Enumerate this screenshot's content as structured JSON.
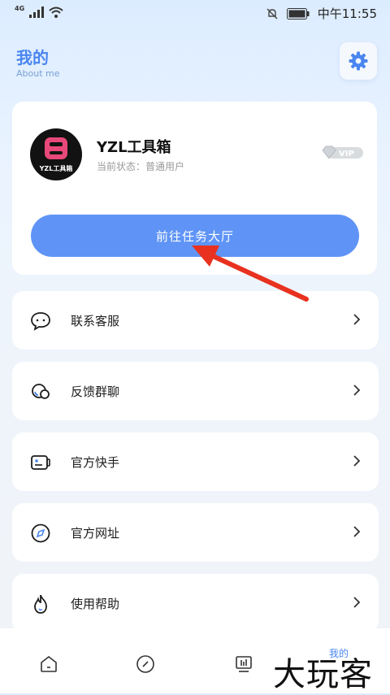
{
  "status_bar": {
    "network": "4G",
    "time": "中午11:55"
  },
  "header": {
    "title": "我的",
    "subtitle": "About me"
  },
  "profile": {
    "avatar_text": "YZL工具箱",
    "name": "YZL工具箱",
    "status": "当前状态：普通用户",
    "badge": "VIP",
    "task_button": "前往任务大厅"
  },
  "menu": [
    {
      "label": "联系客服",
      "icon": "chat-bubble-icon"
    },
    {
      "label": "反馈群聊",
      "icon": "group-chat-icon"
    },
    {
      "label": "官方快手",
      "icon": "video-camera-icon"
    },
    {
      "label": "官方网址",
      "icon": "compass-icon"
    },
    {
      "label": "使用帮助",
      "icon": "fire-icon"
    }
  ],
  "bottom_nav": {
    "active_label": "我的"
  },
  "watermark": "大玩客",
  "colors": {
    "accent": "#4a86f0",
    "button": "#5f94f6",
    "annotation_arrow": "#e8321f"
  }
}
